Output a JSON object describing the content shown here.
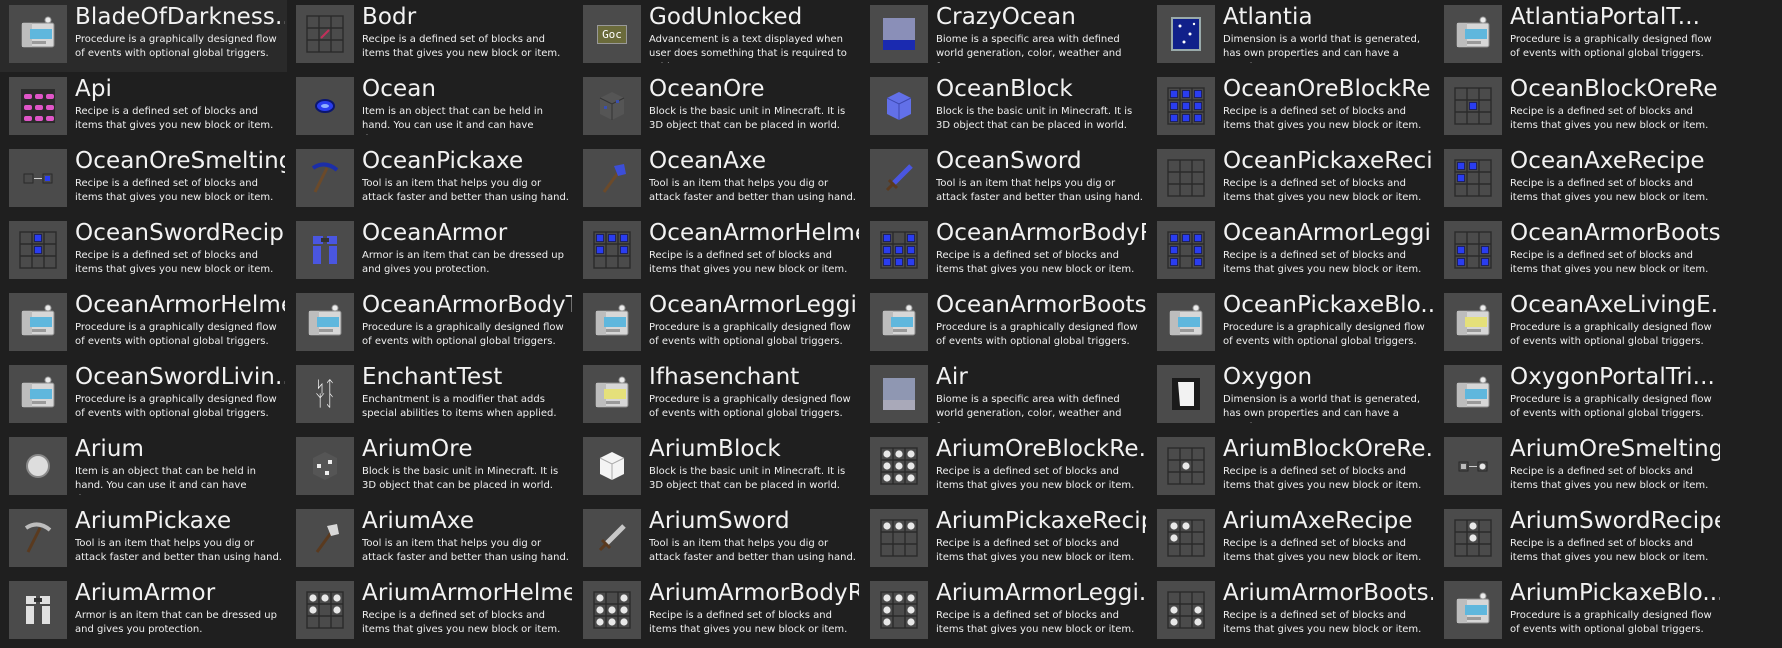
{
  "workspace": {
    "elements": [
      {
        "name": "BladeOfDarkness...",
        "desc": "Procedure is a graphically designed flow of events with optional global triggers.",
        "icon": "procedure-icon"
      },
      {
        "name": "Bodr",
        "desc": "Recipe is a defined set of blocks and items that gives you new block or item.",
        "icon": "recipe-icon"
      },
      {
        "name": "GodUnlocked",
        "desc": "Advancement is a text displayed when user does something that is required to achieve.",
        "icon": "advancement-icon"
      },
      {
        "name": "CrazyOcean",
        "desc": "Biome is a specific area with defined world generation, color, weather and fauna.",
        "icon": "biome-ocean-icon"
      },
      {
        "name": "Atlantia",
        "desc": "Dimension is a world that is generated, has own properties and can have a portal.",
        "icon": "dimension-portal-icon"
      },
      {
        "name": "AtlantiaPortalT...",
        "desc": "Procedure is a graphically designed flow of events with optional global triggers.",
        "icon": "procedure-icon"
      },
      {
        "name": "Api",
        "desc": "Recipe is a defined set of blocks and items that gives you new block or item.",
        "icon": "recipe-grid-gems-icon"
      },
      {
        "name": "Ocean",
        "desc": "Item is an object that can be held in hand. You can use it and can have damage.",
        "icon": "ocean-gem-icon"
      },
      {
        "name": "OceanOre",
        "desc": "Block is the basic unit in Minecraft. It is 3D object that can be placed in world.",
        "icon": "ore-block-icon"
      },
      {
        "name": "OceanBlock",
        "desc": "Block is the basic unit in Minecraft. It is 3D object that can be placed in world.",
        "icon": "ocean-block-icon"
      },
      {
        "name": "OceanOreBlockRe...",
        "desc": "Recipe is a defined set of blocks and items that gives you new block or item.",
        "icon": "recipe-full-blue-icon"
      },
      {
        "name": "OceanBlockOreRe...",
        "desc": "Recipe is a defined set of blocks and items that gives you new block or item.",
        "icon": "recipe-center-blue-icon"
      },
      {
        "name": "OceanOreSmelting",
        "desc": "Recipe is a defined set of blocks and items that gives you new block or item.",
        "icon": "smelting-icon"
      },
      {
        "name": "OceanPickaxe",
        "desc": "Tool is an item that helps you dig or attack faster and better than using hand.",
        "icon": "ocean-pickaxe-icon"
      },
      {
        "name": "OceanAxe",
        "desc": "Tool is an item that helps you dig or attack faster and better than using hand.",
        "icon": "ocean-axe-icon"
      },
      {
        "name": "OceanSword",
        "desc": "Tool is an item that helps you dig or attack faster and better than using hand.",
        "icon": "ocean-sword-icon"
      },
      {
        "name": "OceanPickaxeRecipe",
        "desc": "Recipe is a defined set of blocks and items that gives you new block or item.",
        "icon": "recipe-empty-icon"
      },
      {
        "name": "OceanAxeRecipe",
        "desc": "Recipe is a defined set of blocks and items that gives you new block or item.",
        "icon": "recipe-axe-blue-icon"
      },
      {
        "name": "OceanSwordRecipe",
        "desc": "Recipe is a defined set of blocks and items that gives you new block or item.",
        "icon": "recipe-sword-blue-icon"
      },
      {
        "name": "OceanArmor",
        "desc": "Armor is an item that can be dressed up and gives you protection.",
        "icon": "ocean-armor-icon"
      },
      {
        "name": "OceanArmorHelme...",
        "desc": "Recipe is a defined set of blocks and items that gives you new block or item.",
        "icon": "recipe-helmet-blue-icon"
      },
      {
        "name": "OceanArmorBodyR...",
        "desc": "Recipe is a defined set of blocks and items that gives you new block or item.",
        "icon": "recipe-body-blue-icon"
      },
      {
        "name": "OceanArmorLeggi...",
        "desc": "Recipe is a defined set of blocks and items that gives you new block or item.",
        "icon": "recipe-legs-blue-icon"
      },
      {
        "name": "OceanArmorBoots...",
        "desc": "Recipe is a defined set of blocks and items that gives you new block or item.",
        "icon": "recipe-boots-blue-icon"
      },
      {
        "name": "OceanArmorHelme...",
        "desc": "Procedure is a graphically designed flow of events with optional global triggers.",
        "icon": "procedure-icon"
      },
      {
        "name": "OceanArmorBodyT...",
        "desc": "Procedure is a graphically designed flow of events with optional global triggers.",
        "icon": "procedure-icon"
      },
      {
        "name": "OceanArmorLeggi...",
        "desc": "Procedure is a graphically designed flow of events with optional global triggers.",
        "icon": "procedure-icon"
      },
      {
        "name": "OceanArmorBoots...",
        "desc": "Procedure is a graphically designed flow of events with optional global triggers.",
        "icon": "procedure-icon"
      },
      {
        "name": "OceanPickaxeBlo...",
        "desc": "Procedure is a graphically designed flow of events with optional global triggers.",
        "icon": "procedure-icon"
      },
      {
        "name": "OceanAxeLivingE...",
        "desc": "Procedure is a graphically designed flow of events with optional global triggers.",
        "icon": "procedure-yellow-icon"
      },
      {
        "name": "OceanSwordLivin...",
        "desc": "Procedure is a graphically designed flow of events with optional global triggers.",
        "icon": "procedure-icon"
      },
      {
        "name": "EnchantTest",
        "desc": "Enchantment is a modifier that adds special abilities to items when applied.",
        "icon": "enchantment-icon"
      },
      {
        "name": "Ifhasenchant",
        "desc": "Procedure is a graphically designed flow of events with optional global triggers.",
        "icon": "procedure-yellow-icon"
      },
      {
        "name": "Air",
        "desc": "Biome is a specific area with defined world generation, color, weather and fauna.",
        "icon": "biome-air-icon"
      },
      {
        "name": "Oxygon",
        "desc": "Dimension is a world that is generated, has own properties and can have a portal.",
        "icon": "dimension-white-portal-icon"
      },
      {
        "name": "OxygonPortalTri...",
        "desc": "Procedure is a graphically designed flow of events with optional global triggers.",
        "icon": "procedure-icon"
      },
      {
        "name": "Arium",
        "desc": "Item is an object that can be held in hand. You can use it and can have damage.",
        "icon": "arium-gem-icon"
      },
      {
        "name": "AriumOre",
        "desc": "Block is the basic unit in Minecraft. It is 3D object that can be placed in world.",
        "icon": "arium-ore-icon"
      },
      {
        "name": "AriumBlock",
        "desc": "Block is the basic unit in Minecraft. It is 3D object that can be placed in world.",
        "icon": "arium-block-icon"
      },
      {
        "name": "AriumOreBlockRe...",
        "desc": "Recipe is a defined set of blocks and items that gives you new block or item.",
        "icon": "recipe-full-white-icon"
      },
      {
        "name": "AriumBlockOreRe...",
        "desc": "Recipe is a defined set of blocks and items that gives you new block or item.",
        "icon": "recipe-center-white-icon"
      },
      {
        "name": "AriumOreSmelting",
        "desc": "Recipe is a defined set of blocks and items that gives you new block or item.",
        "icon": "smelting-white-icon"
      },
      {
        "name": "AriumPickaxe",
        "desc": "Tool is an item that helps you dig or attack faster and better than using hand.",
        "icon": "arium-pickaxe-icon"
      },
      {
        "name": "AriumAxe",
        "desc": "Tool is an item that helps you dig or attack faster and better than using hand.",
        "icon": "arium-axe-icon"
      },
      {
        "name": "AriumSword",
        "desc": "Tool is an item that helps you dig or attack faster and better than using hand.",
        "icon": "arium-sword-icon"
      },
      {
        "name": "AriumPickaxeRecipe",
        "desc": "Recipe is a defined set of blocks and items that gives you new block or item.",
        "icon": "recipe-pickaxe-white-icon"
      },
      {
        "name": "AriumAxeRecipe",
        "desc": "Recipe is a defined set of blocks and items that gives you new block or item.",
        "icon": "recipe-axe-white-icon"
      },
      {
        "name": "AriumSwordRecipe",
        "desc": "Recipe is a defined set of blocks and items that gives you new block or item.",
        "icon": "recipe-sword-white-icon"
      },
      {
        "name": "AriumArmor",
        "desc": "Armor is an item that can be dressed up and gives you protection.",
        "icon": "arium-armor-icon"
      },
      {
        "name": "AriumArmorHelme...",
        "desc": "Recipe is a defined set of blocks and items that gives you new block or item.",
        "icon": "recipe-helmet-white-icon"
      },
      {
        "name": "AriumArmorBodyR...",
        "desc": "Recipe is a defined set of blocks and items that gives you new block or item.",
        "icon": "recipe-body-white-icon"
      },
      {
        "name": "AriumArmorLeggi...",
        "desc": "Recipe is a defined set of blocks and items that gives you new block or item.",
        "icon": "recipe-legs-white-icon"
      },
      {
        "name": "AriumArmorBoots...",
        "desc": "Recipe is a defined set of blocks and items that gives you new block or item.",
        "icon": "recipe-boots-white-icon"
      },
      {
        "name": "AriumPickaxeBlo...",
        "desc": "Procedure is a graphically designed flow of events with optional global triggers.",
        "icon": "procedure-icon"
      }
    ],
    "advancement_icon_text": "Goc",
    "colors": {
      "background": "#1f1f1f",
      "thumb_bg": "#4b4b4b",
      "ocean_blue": "#2a3df0",
      "arium_white": "#e8e8e8",
      "procedure_blue": "#5fb7dd",
      "procedure_yellow": "#e5e07a"
    }
  }
}
